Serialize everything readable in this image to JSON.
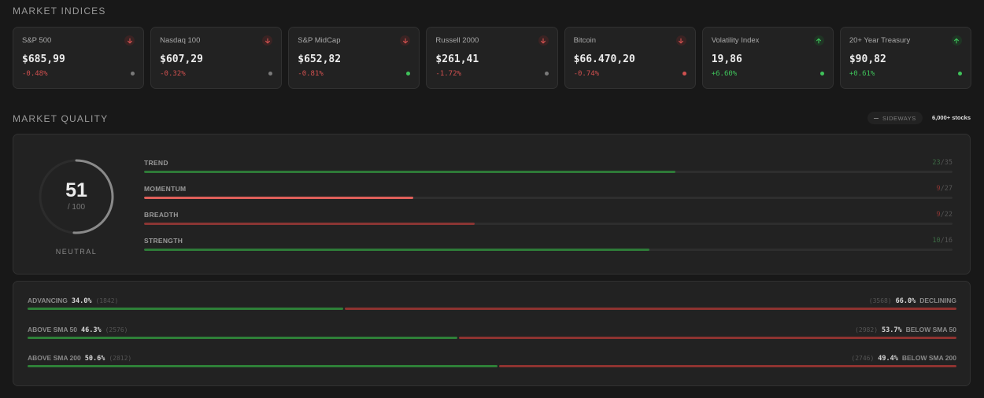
{
  "sections": {
    "indices_title": "MARKET INDICES",
    "quality_title": "MARKET QUALITY"
  },
  "indices": [
    {
      "name": "S&P 500",
      "price": "$685,99",
      "change": "-0.48%",
      "direction": "down",
      "status": "neutral"
    },
    {
      "name": "Nasdaq 100",
      "price": "$607,29",
      "change": "-0.32%",
      "direction": "down",
      "status": "neutral"
    },
    {
      "name": "S&P MidCap",
      "price": "$652,82",
      "change": "-0.81%",
      "direction": "down",
      "status": "good"
    },
    {
      "name": "Russell 2000",
      "price": "$261,41",
      "change": "-1.72%",
      "direction": "down",
      "status": "neutral"
    },
    {
      "name": "Bitcoin",
      "price": "$66.470,20",
      "change": "-0.74%",
      "direction": "down",
      "status": "bad"
    },
    {
      "name": "Volatility Index",
      "price": "19,86",
      "change": "+6.60%",
      "direction": "up",
      "status": "good"
    },
    {
      "name": "20+ Year Treasury",
      "price": "$90,82",
      "change": "+0.61%",
      "direction": "up",
      "status": "good"
    }
  ],
  "quality": {
    "regime": "SIDEWAYS",
    "universe": "6,000+ stocks",
    "score": "51",
    "max": "/ 100",
    "score_fraction": 0.51,
    "label": "NEUTRAL",
    "metrics": [
      {
        "name": "TREND",
        "value": "23",
        "max": "/35",
        "fraction": 0.657,
        "color": "green"
      },
      {
        "name": "MOMENTUM",
        "value": "9",
        "max": "/27",
        "fraction": 0.333,
        "color": "red-bright"
      },
      {
        "name": "BREADTH",
        "value": "9",
        "max": "/22",
        "fraction": 0.409,
        "color": "red-dark"
      },
      {
        "name": "STRENGTH",
        "value": "10",
        "max": "/16",
        "fraction": 0.625,
        "color": "green"
      }
    ]
  },
  "breadth": [
    {
      "left_label": "ADVANCING",
      "left_pct": "34.0%",
      "left_count": "(1842)",
      "right_count": "(3568)",
      "right_pct": "66.0%",
      "right_label": "DECLINING",
      "fraction": 0.34
    },
    {
      "left_label": "ABOVE  SMA 50",
      "left_pct": "46.3%",
      "left_count": "(2576)",
      "right_count": "(2982)",
      "right_pct": "53.7%",
      "right_label": "BELOW  SMA 50",
      "fraction": 0.463
    },
    {
      "left_label": "ABOVE  SMA 200",
      "left_pct": "50.6%",
      "left_count": "(2812)",
      "right_count": "(2746)",
      "right_pct": "49.4%",
      "right_label": "BELOW  SMA 200",
      "fraction": 0.506
    }
  ],
  "colors": {
    "good": "#3fc25a",
    "bad": "#d0504f",
    "neutral": "#7a7a7a",
    "green": "#2e7a38",
    "red-bright": "#e0605a",
    "red-dark": "#8a3533"
  }
}
